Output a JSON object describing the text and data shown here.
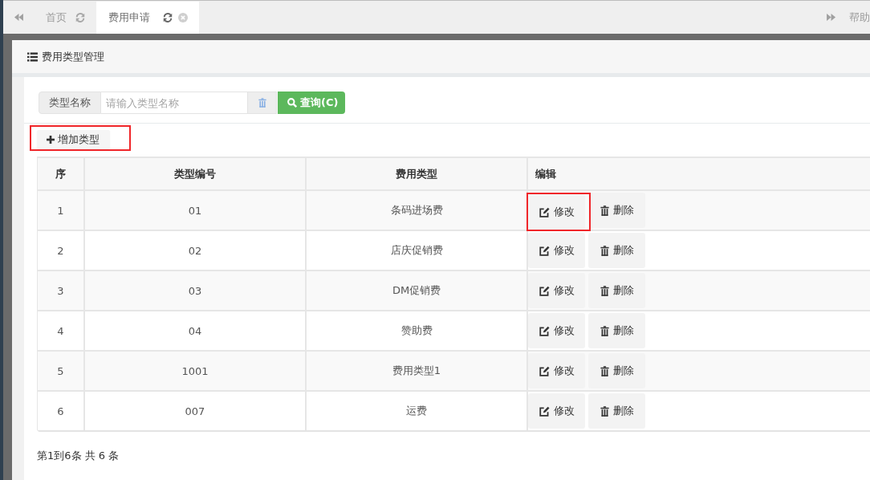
{
  "tabs": [
    {
      "label": "首页",
      "selected": false,
      "closable": false
    },
    {
      "label": "费用申请",
      "selected": true,
      "closable": true
    }
  ],
  "help_tab": {
    "label": "帮助"
  },
  "panel": {
    "title": "费用类型管理"
  },
  "search": {
    "label": "类型名称",
    "placeholder": "请输入类型名称",
    "button": "查询(C)"
  },
  "add_button": {
    "label": "增加类型",
    "highlighted": true
  },
  "table": {
    "columns": [
      "序",
      "类型编号",
      "费用类型",
      "编辑"
    ],
    "rows": [
      {
        "cells": [
          "1",
          "01",
          "条码进场费"
        ],
        "actions": [
          {
            "kind": "edit",
            "label": "修改",
            "highlighted": true
          },
          {
            "kind": "delete",
            "label": "删除",
            "highlighted": false
          }
        ]
      },
      {
        "cells": [
          "2",
          "02",
          "店庆促销费"
        ],
        "actions": [
          {
            "kind": "edit",
            "label": "修改",
            "highlighted": false
          },
          {
            "kind": "delete",
            "label": "删除",
            "highlighted": false
          }
        ]
      },
      {
        "cells": [
          "3",
          "03",
          "DM促销费"
        ],
        "actions": [
          {
            "kind": "edit",
            "label": "修改",
            "highlighted": false
          },
          {
            "kind": "delete",
            "label": "删除",
            "highlighted": false
          }
        ]
      },
      {
        "cells": [
          "4",
          "04",
          "赞助费"
        ],
        "actions": [
          {
            "kind": "edit",
            "label": "修改",
            "highlighted": false
          },
          {
            "kind": "delete",
            "label": "删除",
            "highlighted": false
          }
        ]
      },
      {
        "cells": [
          "5",
          "1001",
          "费用类型1"
        ],
        "actions": [
          {
            "kind": "edit",
            "label": "修改",
            "highlighted": false
          },
          {
            "kind": "delete",
            "label": "删除",
            "highlighted": false
          }
        ]
      },
      {
        "cells": [
          "6",
          "007",
          "运费"
        ],
        "actions": [
          {
            "kind": "edit",
            "label": "修改",
            "highlighted": false
          },
          {
            "kind": "delete",
            "label": "删除",
            "highlighted": false
          }
        ]
      }
    ]
  },
  "pagination": {
    "summary": "第1到6条 共 6 条"
  }
}
